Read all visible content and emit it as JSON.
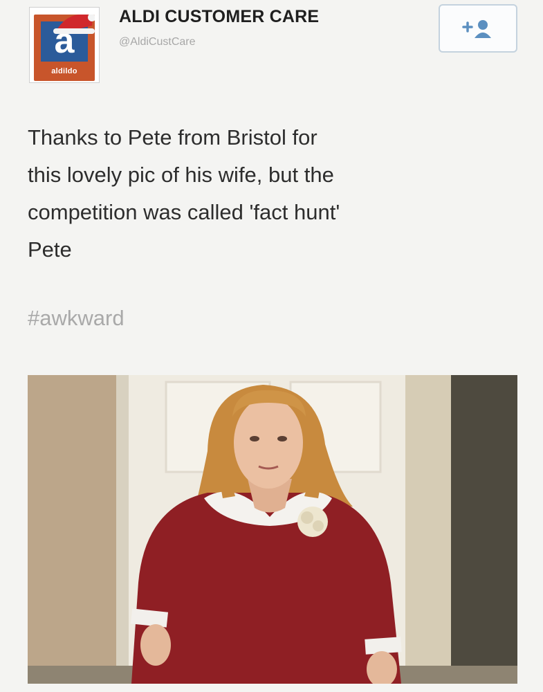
{
  "account": {
    "display_name": "ALDI CUSTOMER CARE",
    "handle": "@AldiCustCare",
    "avatar_caption": "aldildo",
    "avatar_letter": "a"
  },
  "follow_button": {
    "icon": "add-user-icon"
  },
  "tweet": {
    "text": "Thanks to Pete from Bristol for\nthis lovely pic of his wife, but the\ncompetition was called 'fact hunt'\nPete",
    "hashtag": "#awkward"
  },
  "colors": {
    "logo_orange": "#c8552b",
    "logo_blue": "#2b5b9a",
    "hashtag_gray": "#a9a9a9",
    "follow_border": "#c4d2de",
    "sweater_red": "#8f1f24"
  }
}
